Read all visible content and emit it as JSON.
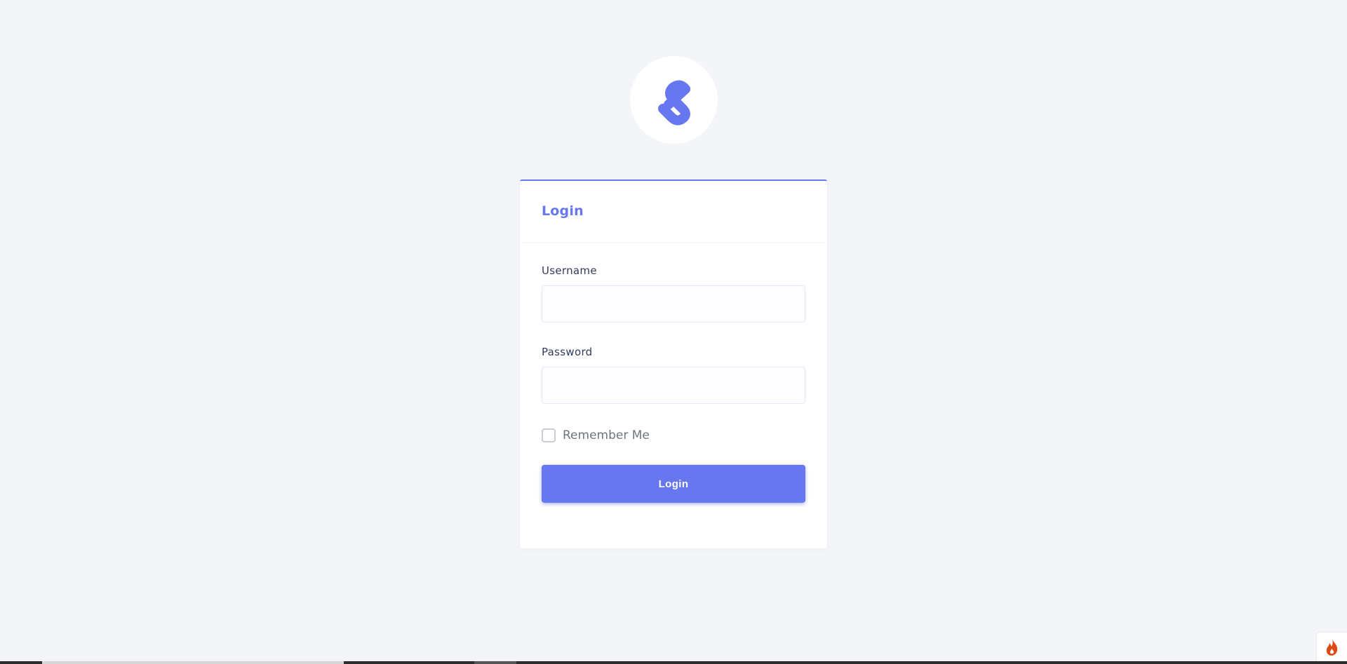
{
  "logo": {
    "icon": "stisla-s-logo",
    "color": "#6777ef"
  },
  "card": {
    "title": "Login",
    "accent_color": "#6777ef"
  },
  "form": {
    "username_label": "Username",
    "username_value": "",
    "password_label": "Password",
    "password_value": "",
    "remember_label": "Remember Me",
    "remember_checked": false,
    "submit_label": "Login"
  },
  "debug_toolbar": {
    "icon": "flame-icon",
    "color": "#dd4814"
  }
}
